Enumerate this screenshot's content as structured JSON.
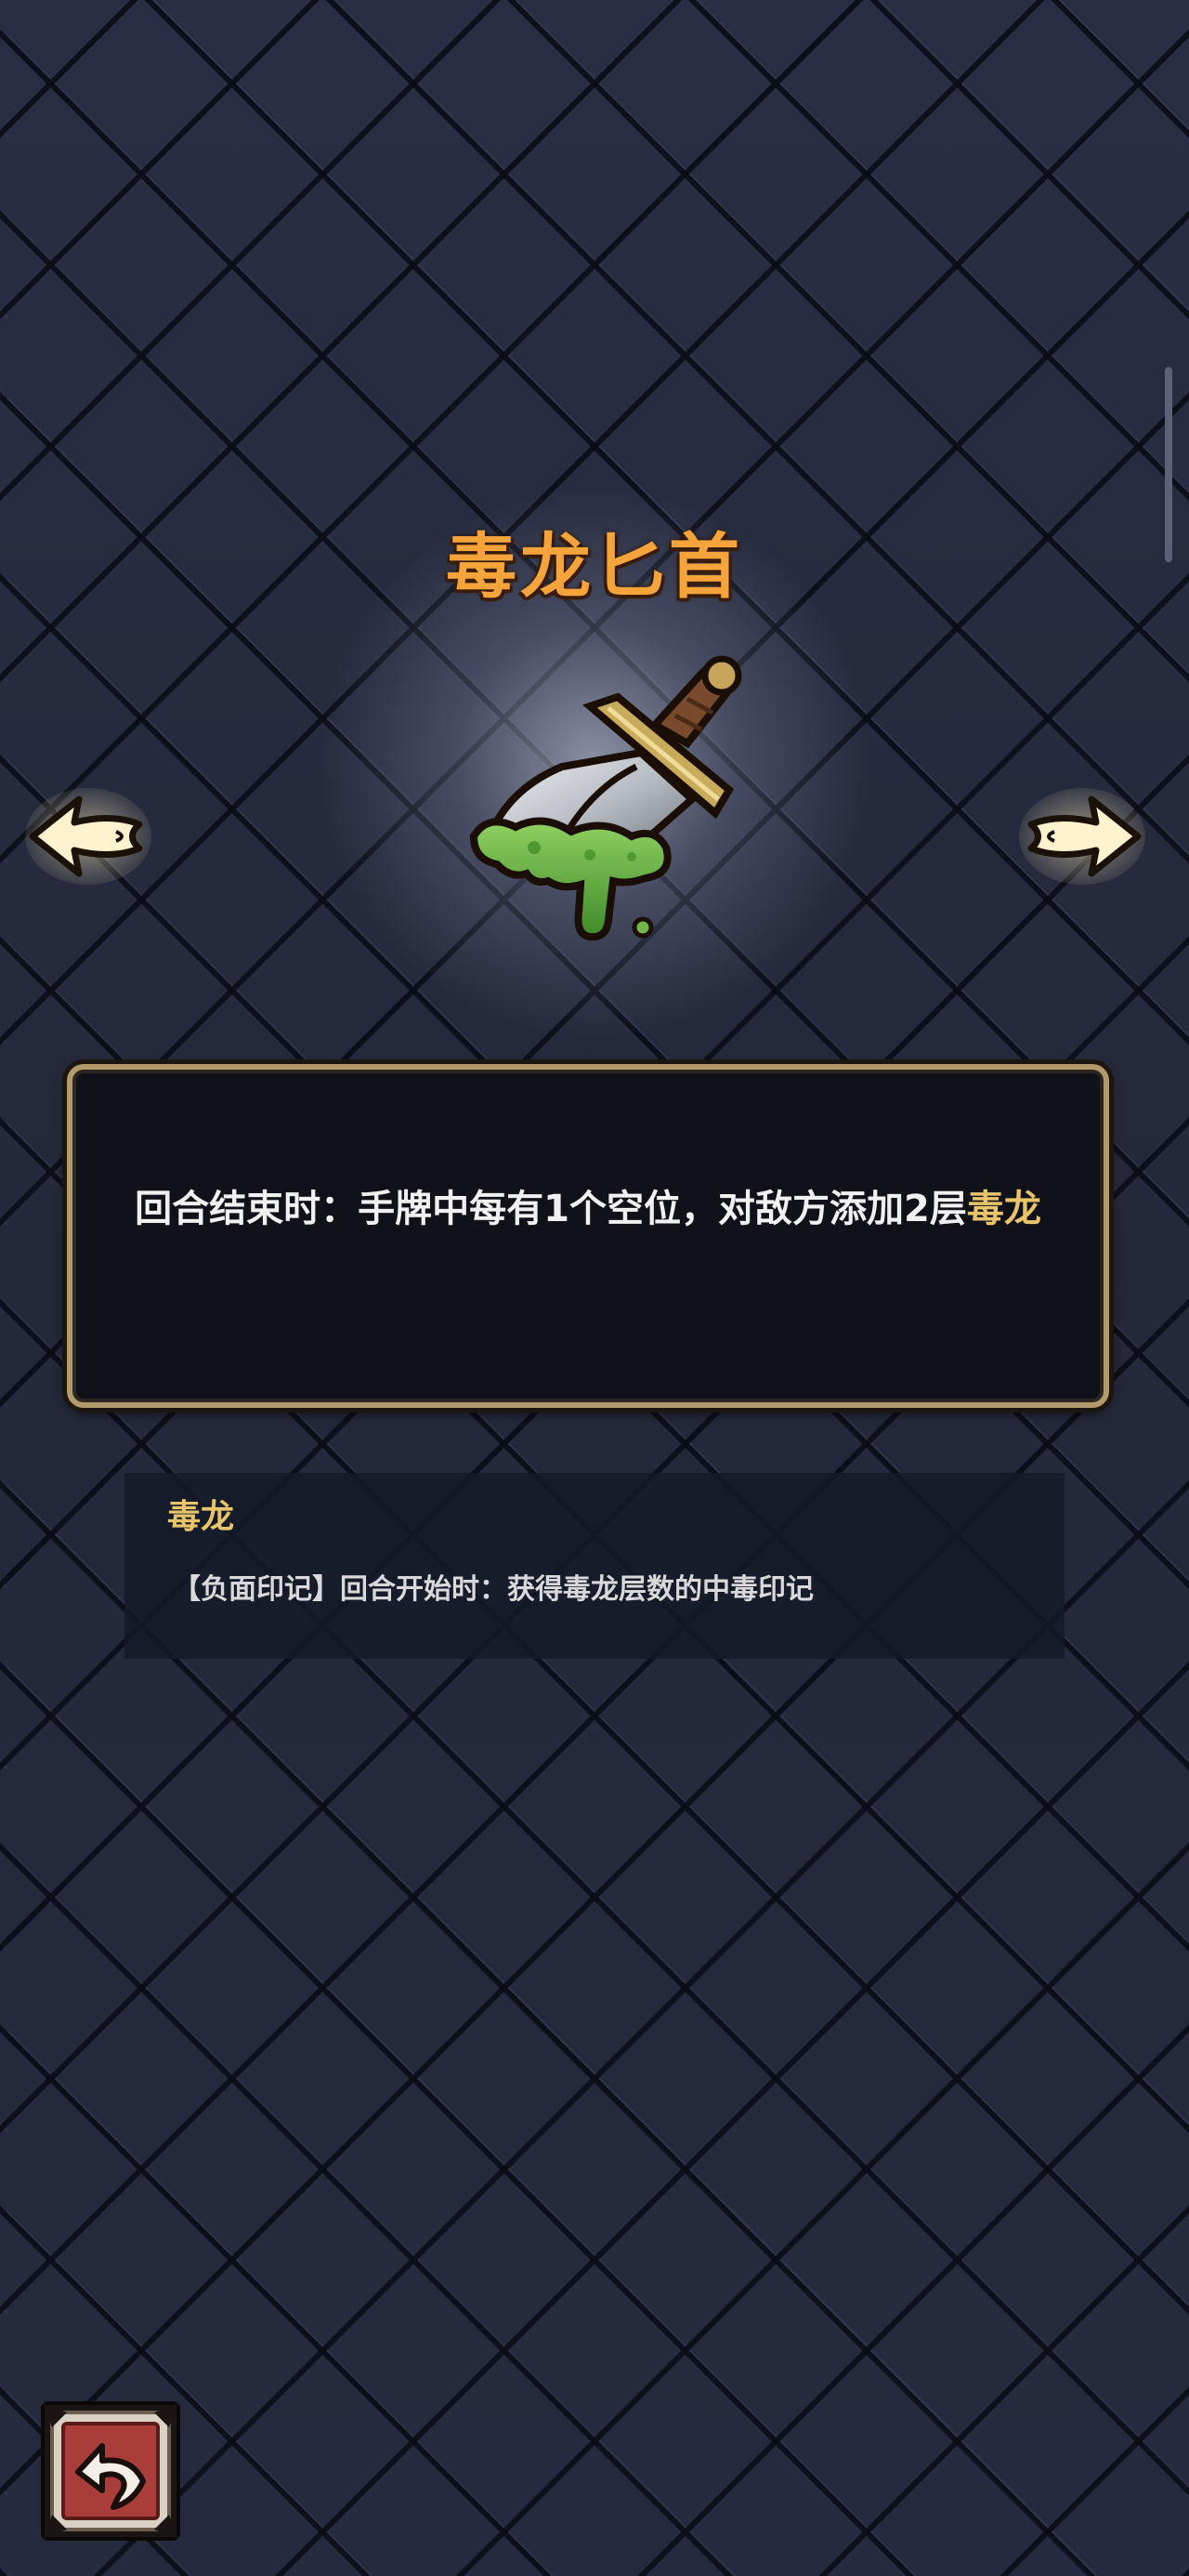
{
  "item": {
    "name": "毒龙匕首",
    "description_main": "回合结束时：手牌中每有1个空位，对敌方添加2层",
    "description_keyword": "毒龙"
  },
  "term": {
    "name": "毒龙",
    "description": "【负面印记】回合开始时：获得毒龙层数的中毒印记"
  },
  "icons": {
    "item": "poison-dagger-icon",
    "prev": "arrow-left-icon",
    "next": "arrow-right-icon",
    "back": "return-arrow-icon"
  },
  "colors": {
    "title": "#f4a43a",
    "keyword": "#e8c46a",
    "frame": "#b29a6a",
    "back_button": "#a83d3a"
  }
}
